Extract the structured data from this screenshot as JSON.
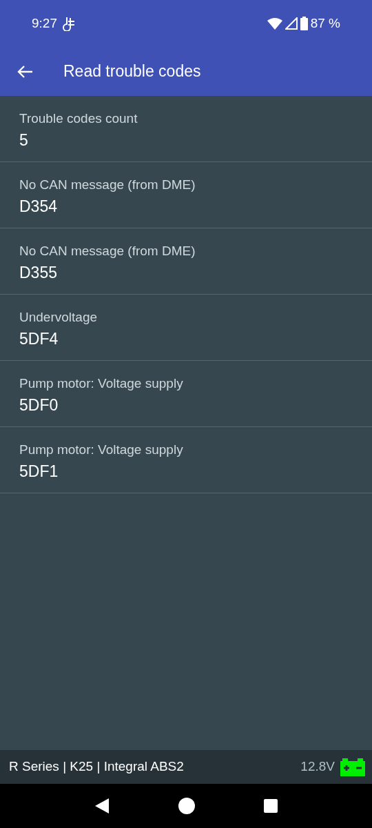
{
  "status_bar": {
    "time": "9:27",
    "battery": "87 %"
  },
  "app_bar": {
    "title": "Read trouble codes"
  },
  "items": [
    {
      "label": "Trouble codes count",
      "value": "5"
    },
    {
      "label": "No CAN message (from DME)",
      "value": "D354"
    },
    {
      "label": "No CAN message (from DME)",
      "value": "D355"
    },
    {
      "label": "Undervoltage",
      "value": "5DF4"
    },
    {
      "label": "Pump motor: Voltage supply",
      "value": "5DF0"
    },
    {
      "label": "Pump motor: Voltage supply",
      "value": "5DF1"
    }
  ],
  "footer": {
    "vehicle": "R Series | K25 | Integral ABS2",
    "voltage": "12.8V"
  }
}
